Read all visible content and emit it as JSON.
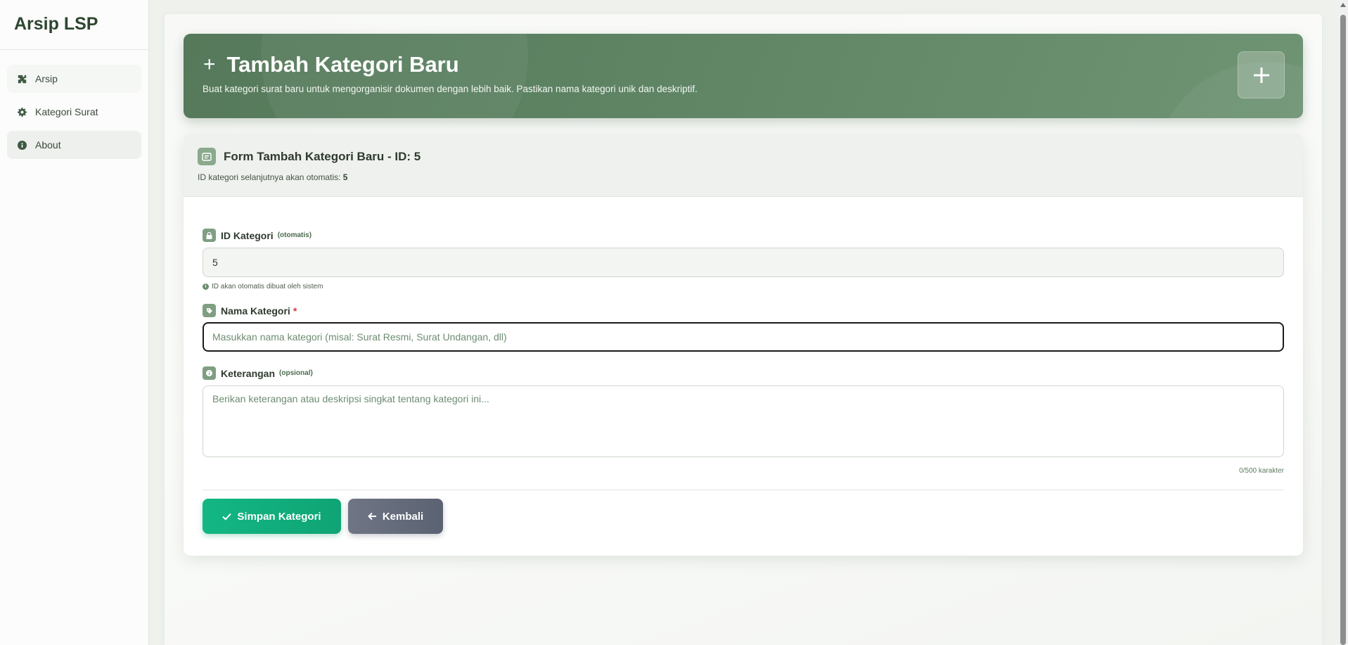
{
  "app": {
    "brand": "Arsip LSP"
  },
  "sidebar": {
    "items": [
      {
        "label": "Arsip",
        "icon": "puzzle-icon"
      },
      {
        "label": "Kategori Surat",
        "icon": "gear-icon"
      },
      {
        "label": "About",
        "icon": "info-icon"
      }
    ]
  },
  "header": {
    "title": "Tambah Kategori Baru",
    "subtitle": "Buat kategori surat baru untuk mengorganisir dokumen dengan lebih baik. Pastikan nama kategori unik dan deskriptif."
  },
  "form": {
    "title": "Form Tambah Kategori Baru - ID: 5",
    "subtitle_prefix": "ID kategori selanjutnya akan otomatis:",
    "next_id": "5",
    "id_field": {
      "label": "ID Kategori",
      "note": "(otomatis)",
      "value": "5",
      "help": "ID akan otomatis dibuat oleh sistem"
    },
    "name_field": {
      "label": "Nama Kategori",
      "required_mark": "*",
      "placeholder": "Masukkan nama kategori (misal: Surat Resmi, Surat Undangan, dll)"
    },
    "desc_field": {
      "label": "Keterangan",
      "note": "(opsional)",
      "placeholder": "Berikan keterangan atau deskripsi singkat tentang kategori ini...",
      "counter": "0/500 karakter"
    },
    "buttons": {
      "save": "Simpan Kategori",
      "back": "Kembali"
    }
  },
  "colors": {
    "accent": "#5f8565",
    "save": "#13b784",
    "back": "#636a7a"
  }
}
